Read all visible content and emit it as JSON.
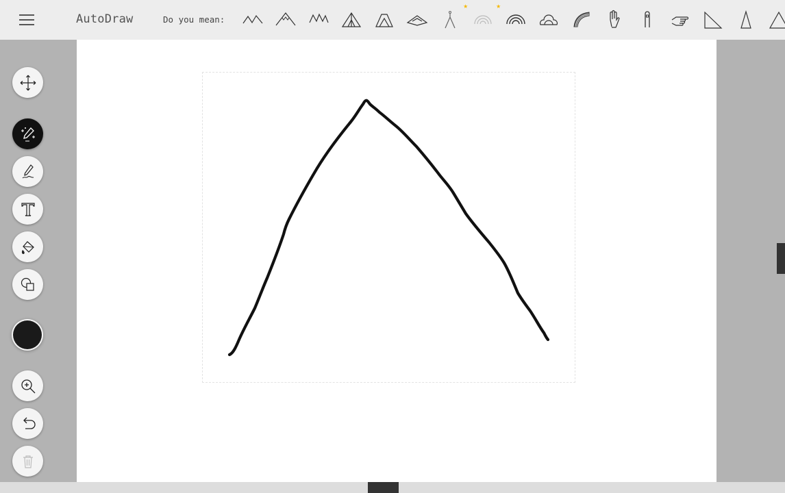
{
  "app": {
    "title": "AutoDraw"
  },
  "toolbar": {
    "menu_icon": "hamburger-menu-icon",
    "suggestions_label": "Do you mean:",
    "suggestions": [
      {
        "icon": "mountain-suggestion-icon"
      },
      {
        "icon": "snowy-mountain-suggestion-icon"
      },
      {
        "icon": "mountain-range-suggestion-icon"
      },
      {
        "icon": "tent-suggestion-icon"
      },
      {
        "icon": "camping-tent-suggestion-icon"
      },
      {
        "icon": "pyramid-tent-suggestion-icon"
      },
      {
        "icon": "wishbone-suggestion-icon",
        "starred": true
      },
      {
        "icon": "rainbow-outline-suggestion-icon",
        "starred": true
      },
      {
        "icon": "rainbow-suggestion-icon"
      },
      {
        "icon": "rainbow-cloud-suggestion-icon"
      },
      {
        "icon": "striped-rainbow-suggestion-icon"
      },
      {
        "icon": "hand-suggestion-icon"
      },
      {
        "icon": "finger-suggestion-icon"
      },
      {
        "icon": "pointing-hand-suggestion-icon"
      },
      {
        "icon": "right-triangle-suggestion-icon"
      },
      {
        "icon": "tall-triangle-suggestion-icon"
      },
      {
        "icon": "triangle-suggestion-icon"
      }
    ]
  },
  "tools": {
    "items": [
      {
        "id": "select",
        "icon": "move-arrows-icon"
      },
      {
        "id": "autodraw",
        "icon": "magic-pen-icon",
        "active": true
      },
      {
        "id": "draw",
        "icon": "pen-icon"
      },
      {
        "id": "type",
        "icon": "text-icon"
      },
      {
        "id": "fill",
        "icon": "paint-bucket-icon"
      },
      {
        "id": "shape",
        "icon": "shapes-icon"
      },
      {
        "id": "zoom",
        "icon": "zoom-in-icon"
      },
      {
        "id": "undo",
        "icon": "undo-icon"
      },
      {
        "id": "delete",
        "icon": "trash-icon",
        "disabled": true
      }
    ],
    "current_color": "#1a1a1a"
  },
  "colors": {
    "topbar": "#ededed",
    "workspace": "#b3b3b3",
    "canvas": "#ffffff",
    "active_tool": "#111111",
    "star": "#f5b800"
  }
}
